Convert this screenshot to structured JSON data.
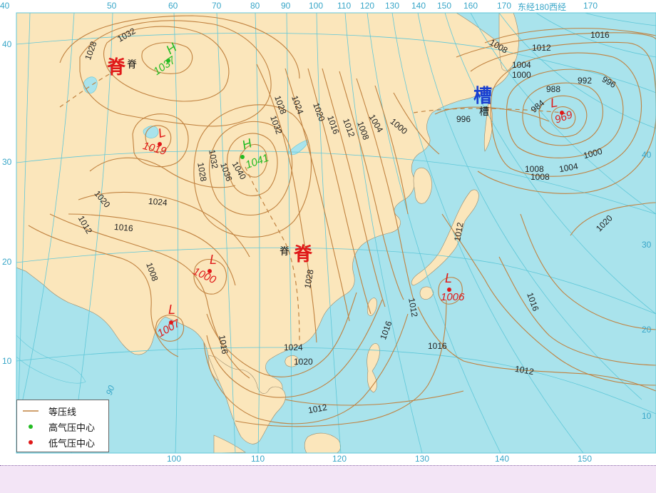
{
  "map": {
    "top_lon_labels": [
      "40",
      "50",
      "60",
      "70",
      "80",
      "90",
      "100",
      "110",
      "120",
      "130",
      "140",
      "150",
      "160",
      "170",
      "东经180西经",
      "170"
    ],
    "left_lat_labels": [
      "40",
      "30",
      "20",
      "10"
    ],
    "right_lat_labels": [
      "40",
      "30",
      "20",
      "10"
    ],
    "bottom_lon_labels": [
      "100",
      "110",
      "120",
      "130",
      "140",
      "150"
    ],
    "meridian_label_90": "90",
    "isobar_labels": [
      "1032",
      "1028",
      "1028",
      "1024",
      "1020",
      "1016",
      "1012",
      "1008",
      "1004",
      "1000",
      "1032",
      "1028",
      "1032",
      "1036",
      "1040",
      "1024",
      "1020",
      "1016",
      "1012",
      "1008",
      "1008",
      "1012",
      "1016",
      "1004",
      "1000",
      "996",
      "992",
      "996",
      "988",
      "984",
      "1000",
      "1004",
      "1008",
      "1020",
      "1012",
      "1016",
      "1028",
      "1024",
      "1020",
      "1016",
      "1012",
      "1016",
      "1012",
      "1008",
      "1016",
      "1012"
    ],
    "pressure_centers": [
      {
        "type": "high",
        "letter": "H",
        "value": "1037"
      },
      {
        "type": "high",
        "letter": "H",
        "value": "1041"
      },
      {
        "type": "low",
        "letter": "L",
        "value": "1019"
      },
      {
        "type": "low",
        "letter": "L",
        "value": "1000"
      },
      {
        "type": "low",
        "letter": "L",
        "value": "1007"
      },
      {
        "type": "low",
        "letter": "L",
        "value": "1006"
      },
      {
        "type": "low",
        "letter": "L",
        "value": "969"
      }
    ],
    "features": {
      "ridge_big": "脊",
      "ridge_small": "脊",
      "trough_big": "槽",
      "trough_small": "槽"
    },
    "colors": {
      "land": "#fbe6bb",
      "sea": "#a9e3ec",
      "isobar": "#c0813f",
      "grid": "#5fc7d8",
      "high": "#22bb22",
      "low": "#e01818",
      "ridge": "#e01818",
      "trough": "#1a3fd0"
    }
  },
  "legend": {
    "isobar": "等压线",
    "high_center": "高气压中心",
    "low_center": "低气压中心"
  }
}
